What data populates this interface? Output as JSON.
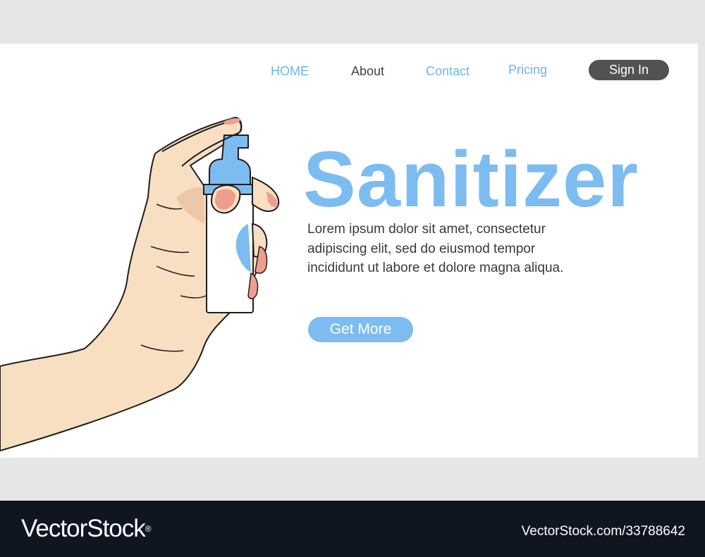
{
  "nav": {
    "home": "HOME",
    "about": "About",
    "contact": "Contact",
    "pricing": "Pricing",
    "sign_in": "Sign In"
  },
  "hero": {
    "title": "Sanitizer",
    "body": "Lorem ipsum dolor sit amet, consectetur adipiscing elit, sed do eiusmod tempor incididunt ut labore et dolore magna aliqua.",
    "cta": "Get More"
  },
  "illustration": {
    "icon": "hand-holding-sanitizer-bottle-icon"
  },
  "watermark": {
    "brand": "VectorStock",
    "registered": "®",
    "url": "VectorStock.com/33788642"
  },
  "colors": {
    "accent": "#7dbcf0",
    "nav_link": "#6db5ee",
    "skin": "#f9dfc2",
    "nail": "#ee9e8e",
    "dark_button": "#525252",
    "footer": "#0f1521"
  }
}
